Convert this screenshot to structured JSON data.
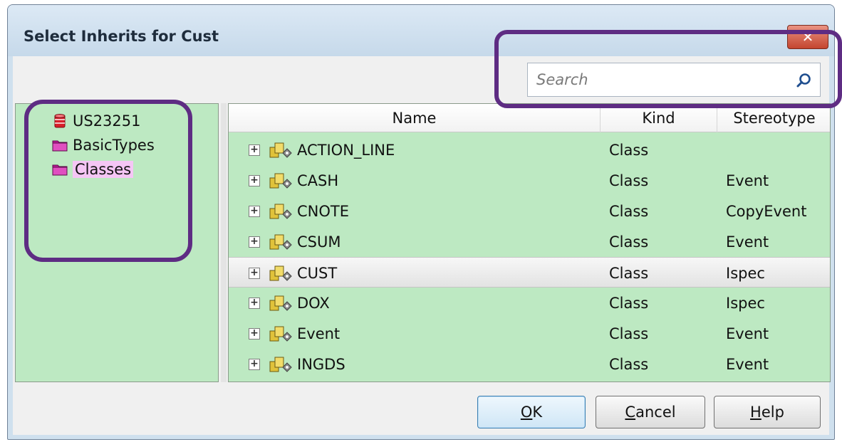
{
  "window": {
    "title": "Select Inherits for Cust",
    "close_label": "✕"
  },
  "search": {
    "placeholder": "Search",
    "icon": "search-icon"
  },
  "tree": {
    "items": [
      {
        "label": "US23251",
        "icon": "database-icon"
      },
      {
        "label": "BasicTypes",
        "icon": "folder-icon"
      },
      {
        "label": "Classes",
        "icon": "folder-icon",
        "selected": true
      }
    ]
  },
  "grid": {
    "columns": [
      "Name",
      "Kind",
      "Stereotype"
    ],
    "rows": [
      {
        "name": "ACTION_LINE",
        "kind": "Class",
        "stereotype": ""
      },
      {
        "name": "CASH",
        "kind": "Class",
        "stereotype": "Event"
      },
      {
        "name": "CNOTE",
        "kind": "Class",
        "stereotype": "CopyEvent"
      },
      {
        "name": "CSUM",
        "kind": "Class",
        "stereotype": "Event"
      },
      {
        "name": "CUST",
        "kind": "Class",
        "stereotype": "Ispec",
        "selected": true
      },
      {
        "name": "DOX",
        "kind": "Class",
        "stereotype": "Ispec"
      },
      {
        "name": "Event",
        "kind": "Class",
        "stereotype": "Event"
      },
      {
        "name": "INGDS",
        "kind": "Class",
        "stereotype": "Event"
      }
    ],
    "expand_glyph": "+"
  },
  "buttons": {
    "ok": {
      "mnemonic": "O",
      "rest": "K"
    },
    "cancel": {
      "mnemonic": "C",
      "rest": "ancel"
    },
    "help": {
      "mnemonic": "H",
      "rest": "elp"
    }
  },
  "colors": {
    "pane_green": "#bde9c2",
    "annotation_purple": "#5e2c83",
    "selected_folder": "#f5c6f5"
  }
}
